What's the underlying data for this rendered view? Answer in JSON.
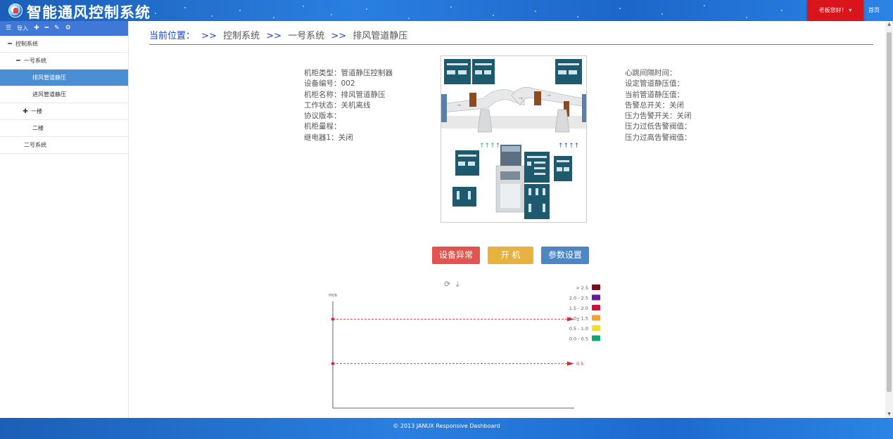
{
  "header": {
    "app_title": "智能通风控制系统",
    "user_greeting": "老板您好！",
    "home_label": "首页"
  },
  "sidebar": {
    "toolbar": {
      "import_label": "导入"
    },
    "items": [
      {
        "label": "控制系统",
        "mark": "minus"
      },
      {
        "label": "一号系统",
        "mark": "minus"
      },
      {
        "label": "排风管道静压",
        "active": true
      },
      {
        "label": "进风管道静压"
      },
      {
        "label": "一楼",
        "mark": "plus"
      },
      {
        "label": "二楼"
      },
      {
        "label": "二号系统"
      }
    ]
  },
  "breadcrumb": {
    "label": "当前位置：",
    "sep": ">>",
    "path": [
      "控制系统",
      "一号系统",
      "排风管道静压"
    ]
  },
  "device_info": {
    "left": [
      "机柜类型：管道静压控制器",
      "设备编号：002",
      "机柜名称：排风管道静压",
      "工作状态：关机离线",
      "协议版本：",
      "机柜量程：",
      "继电器1：关闭"
    ],
    "right": [
      "心跳间隔时间：",
      "设定管道静压值：",
      "当前管道静压值：",
      "告警总开关：关闭",
      "压力告警开关：关闭",
      "压力过低告警阀值：",
      "压力过高告警阀值："
    ]
  },
  "buttons": {
    "fault": "设备异常",
    "start": "开 机",
    "params": "参数设置"
  },
  "chart_data": {
    "type": "line",
    "ylabel": "m/s",
    "ylim": [
      0,
      1.2
    ],
    "mark_lines": [
      {
        "label": "1",
        "value": 1
      },
      {
        "label": "0.5",
        "value": 0.5
      }
    ],
    "series": [],
    "legend": {
      "placement": "top-right",
      "items": [
        {
          "label": "> 2.5",
          "color": "#7b0d1e"
        },
        {
          "label": "2.0 - 2.5",
          "color": "#6a1b9a"
        },
        {
          "label": "1.5 - 2.0",
          "color": "#d0103a"
        },
        {
          "label": "1.0 - 1.5",
          "color": "#f7a035"
        },
        {
          "label": "0.5 - 1.0",
          "color": "#f7dc2e"
        },
        {
          "label": "0.0 - 0.5",
          "color": "#12a56e"
        }
      ]
    },
    "mark_color": "#d9282f"
  },
  "footer": {
    "text": "© 2013 JANUX Responsive Dashboard"
  },
  "colors": {
    "header_blue": "#2a7fe0",
    "sidebar_active": "#4a8fd4",
    "user_red": "#d9151b"
  }
}
